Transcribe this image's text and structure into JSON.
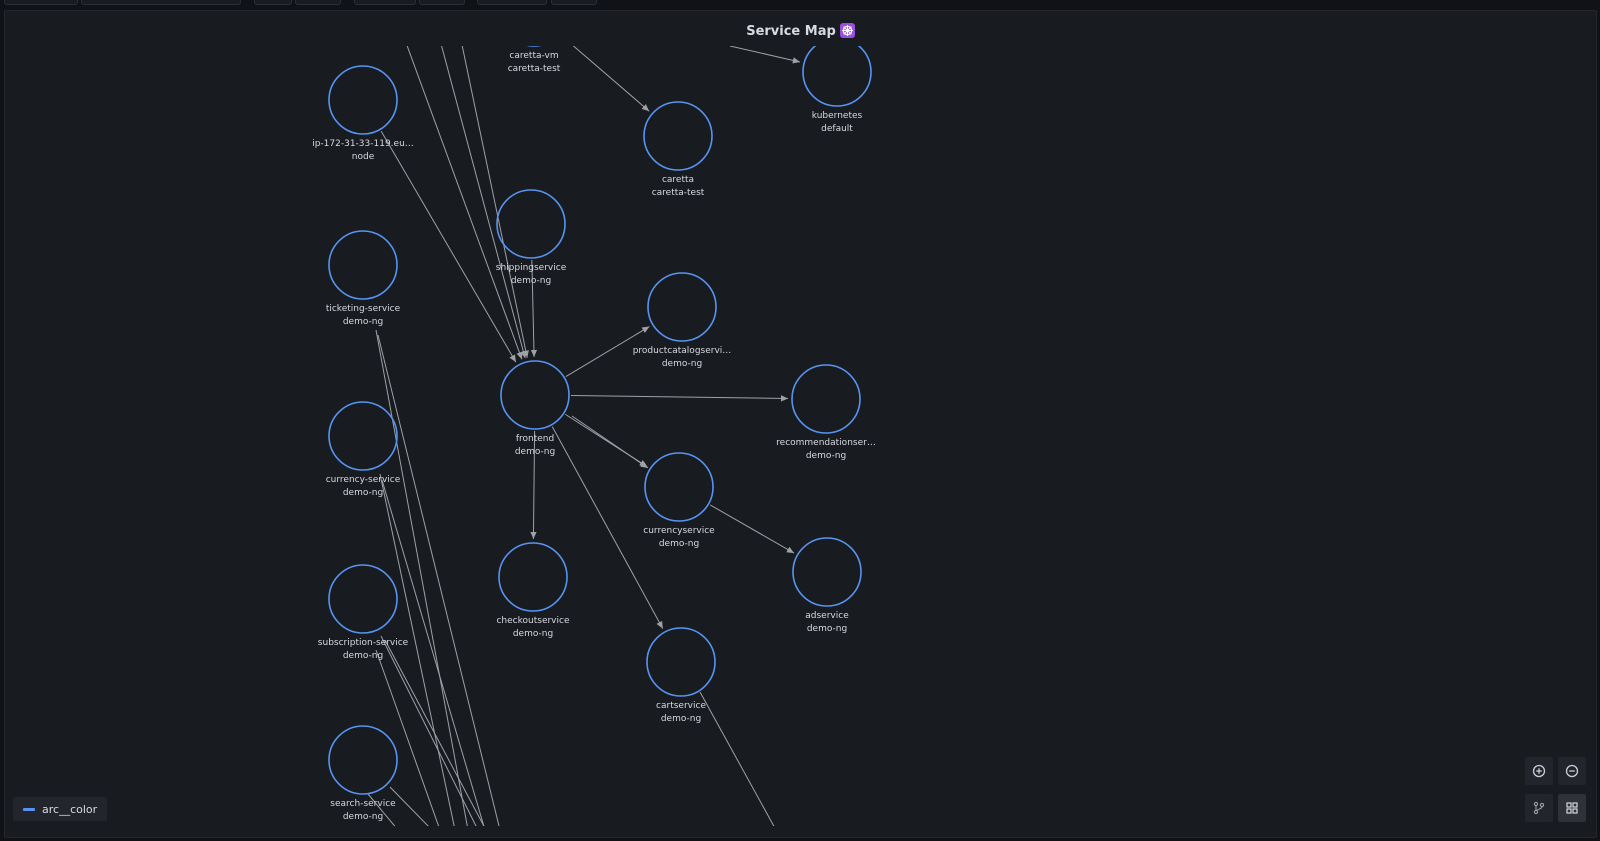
{
  "panel": {
    "title": "Service Map"
  },
  "legend": {
    "label": "arc__color",
    "color": "#5794f2"
  },
  "nodes": [
    {
      "name": "caretta-vm",
      "namespace": "caretta-test"
    },
    {
      "name": "ip-172-31-33-119.eu…",
      "namespace": "node"
    },
    {
      "name": "kubernetes",
      "namespace": "default"
    },
    {
      "name": "caretta",
      "namespace": "caretta-test"
    },
    {
      "name": "shippingservice",
      "namespace": "demo-ng"
    },
    {
      "name": "ticketing-service",
      "namespace": "demo-ng"
    },
    {
      "name": "productcatalogservi…",
      "namespace": "demo-ng"
    },
    {
      "name": "frontend",
      "namespace": "demo-ng"
    },
    {
      "name": "recommendationser…",
      "namespace": "demo-ng"
    },
    {
      "name": "currency-service",
      "namespace": "demo-ng"
    },
    {
      "name": "currencyservice",
      "namespace": "demo-ng"
    },
    {
      "name": "adservice",
      "namespace": "demo-ng"
    },
    {
      "name": "checkoutservice",
      "namespace": "demo-ng"
    },
    {
      "name": "subscription-service",
      "namespace": "demo-ng"
    },
    {
      "name": "cartservice",
      "namespace": "demo-ng"
    },
    {
      "name": "search-service",
      "namespace": "demo-ng"
    }
  ],
  "controls": [
    "zoom-in-icon",
    "zoom-out-icon",
    "graph-layout-icon",
    "grid-layout-icon"
  ],
  "colors": {
    "node_stroke": "#5794f2",
    "edge": "#9fa1a8",
    "background": "#181b1f"
  }
}
